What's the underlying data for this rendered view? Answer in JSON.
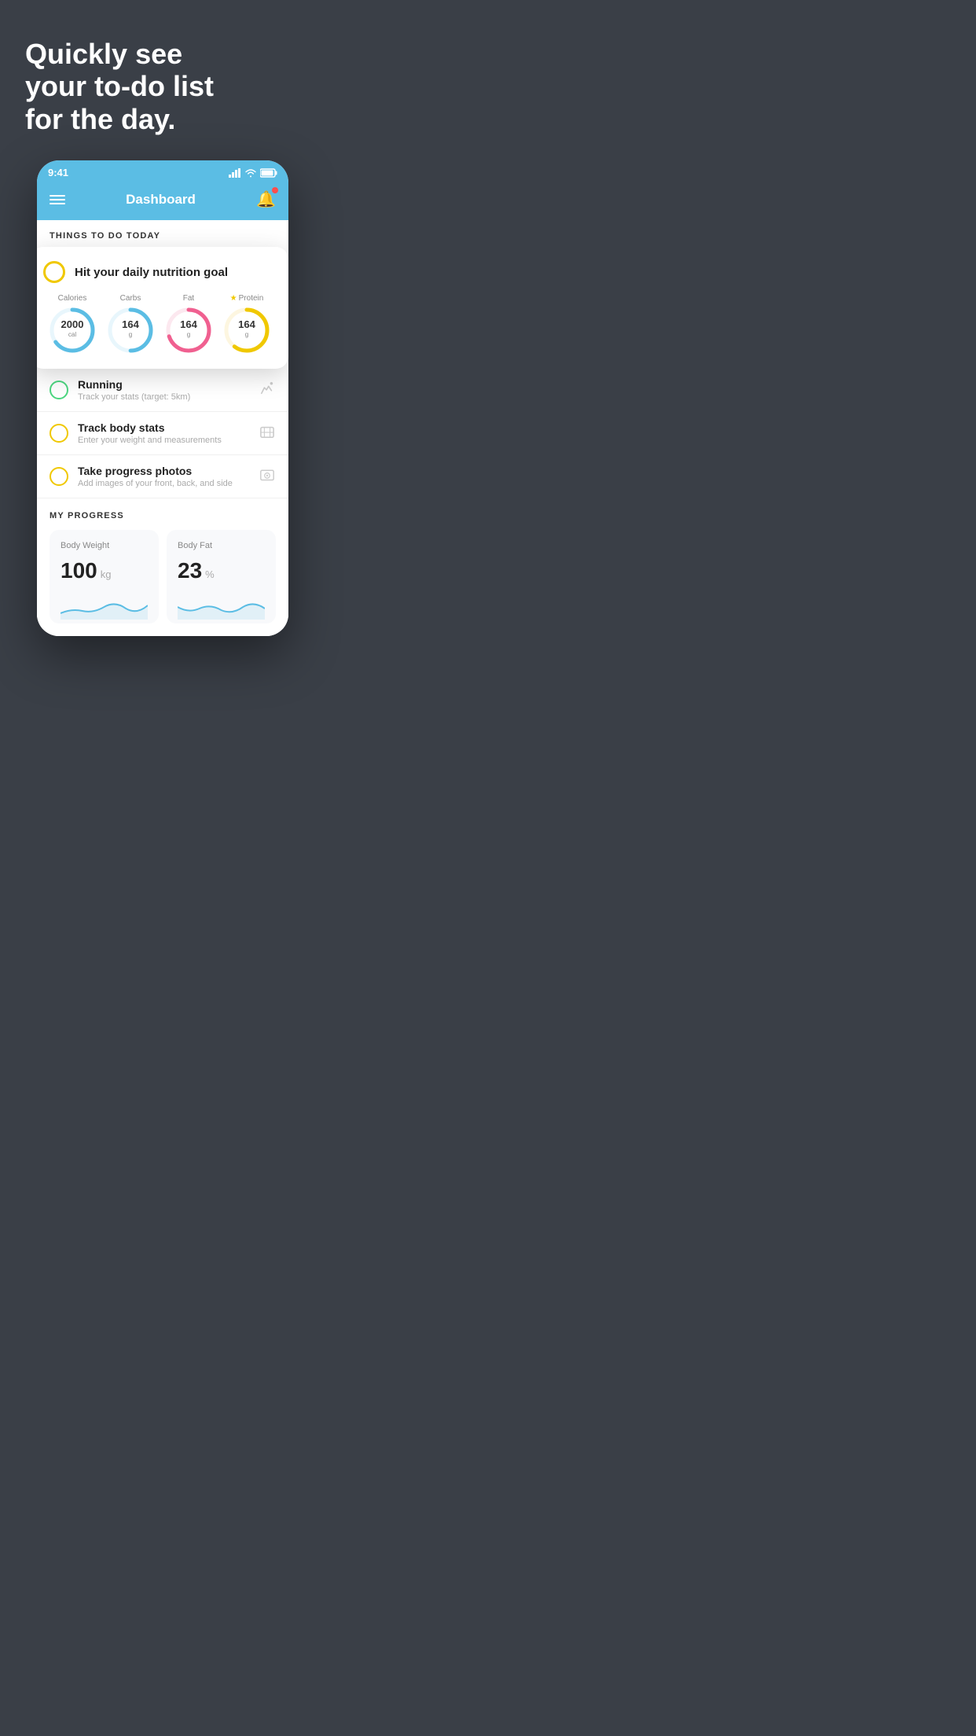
{
  "hero": {
    "line1": "Quickly see",
    "line2": "your to-do list",
    "line3": "for the day."
  },
  "phone": {
    "status_bar": {
      "time": "9:41",
      "signal": "▋▋▋▋",
      "wifi": "wifi",
      "battery": "battery"
    },
    "nav_bar": {
      "title": "Dashboard",
      "menu_label": "menu",
      "bell_label": "notifications"
    },
    "things_to_do": {
      "section_label": "THINGS TO DO TODAY",
      "nutrition_card": {
        "title": "Hit your daily nutrition goal",
        "calories": {
          "label": "Calories",
          "value": "2000",
          "unit": "cal",
          "color": "#5bbde4",
          "progress": 0.65
        },
        "carbs": {
          "label": "Carbs",
          "value": "164",
          "unit": "g",
          "color": "#5bbde4",
          "progress": 0.5
        },
        "fat": {
          "label": "Fat",
          "value": "164",
          "unit": "g",
          "color": "#f06090",
          "progress": 0.7
        },
        "protein": {
          "label": "Protein",
          "value": "164",
          "unit": "g",
          "color": "#f0c800",
          "progress": 0.6
        }
      },
      "todo_items": [
        {
          "id": "running",
          "title": "Running",
          "subtitle": "Track your stats (target: 5km)",
          "circle_color": "green",
          "icon": "👟"
        },
        {
          "id": "track-body",
          "title": "Track body stats",
          "subtitle": "Enter your weight and measurements",
          "circle_color": "yellow",
          "icon": "⚖"
        },
        {
          "id": "progress-photos",
          "title": "Take progress photos",
          "subtitle": "Add images of your front, back, and side",
          "circle_color": "yellow",
          "icon": "🖼"
        }
      ]
    },
    "progress": {
      "section_label": "MY PROGRESS",
      "body_weight": {
        "title": "Body Weight",
        "value": "100",
        "unit": "kg"
      },
      "body_fat": {
        "title": "Body Fat",
        "value": "23",
        "unit": "%"
      }
    }
  }
}
